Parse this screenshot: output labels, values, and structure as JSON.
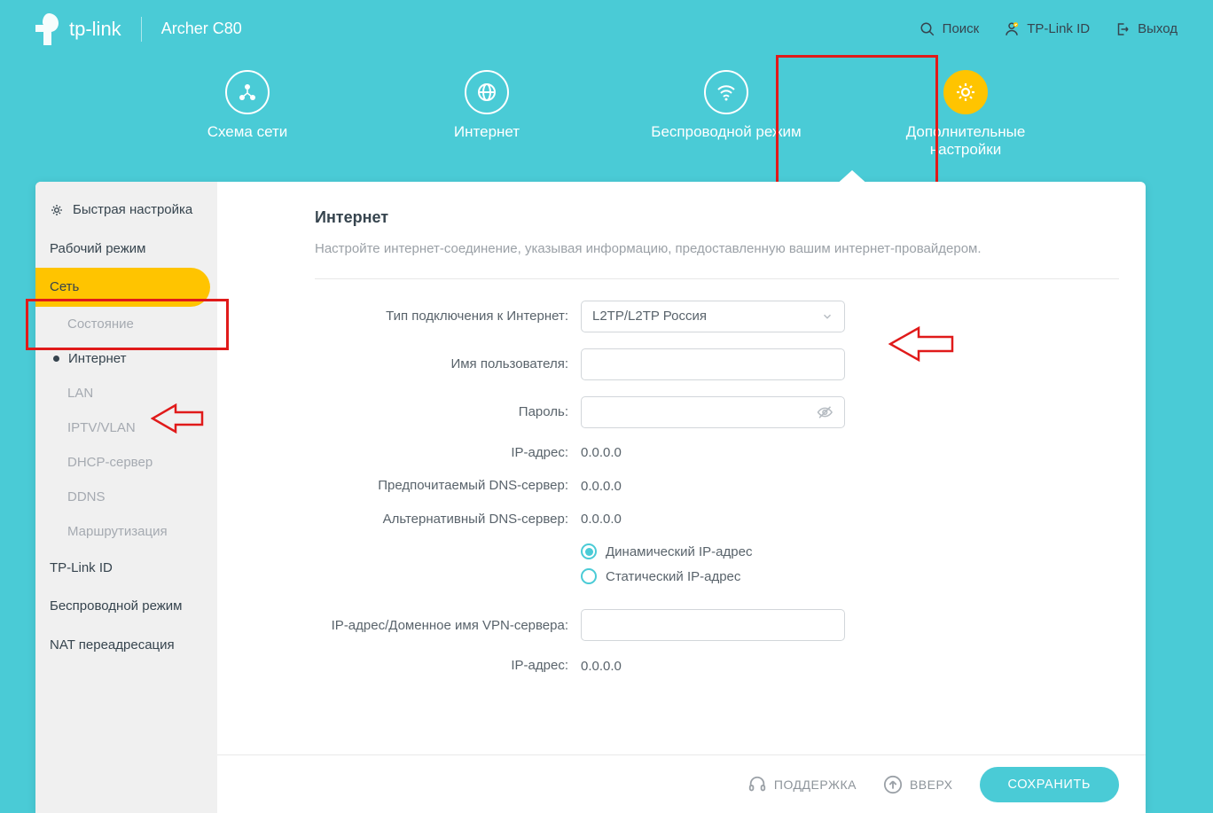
{
  "brand": "tp-link",
  "model": "Archer C80",
  "top_links": {
    "search": "Поиск",
    "tplink_id": "TP-Link ID",
    "logout": "Выход"
  },
  "tabs": {
    "network_map": "Схема сети",
    "internet": "Интернет",
    "wireless": "Беспроводной режим",
    "advanced": "Дополнительные настройки"
  },
  "sidebar": {
    "quick_setup": "Быстрая настройка",
    "operation_mode": "Рабочий режим",
    "network": "Сеть",
    "status": "Состояние",
    "internet": "Интернет",
    "lan": "LAN",
    "iptv": "IPTV/VLAN",
    "dhcp": "DHCP-сервер",
    "ddns": "DDNS",
    "routing": "Маршрутизация",
    "tplink_id": "TP-Link ID",
    "wireless": "Беспроводной режим",
    "nat": "NAT переадресация"
  },
  "page": {
    "title": "Интернет",
    "desc": "Настройте интернет-соединение, указывая информацию, предоставленную вашим интернет-провайдером.",
    "labels": {
      "conn_type": "Тип подключения к Интернет:",
      "username": "Имя пользователя:",
      "password": "Пароль:",
      "ip": "IP-адрес:",
      "pref_dns": "Предпочитаемый DNS-сервер:",
      "alt_dns": "Альтернативный DNS-сервер:",
      "dyn_ip": "Динамический IP-адрес",
      "stat_ip": "Статический IP-адрес",
      "vpn_server": "IP-адрес/Доменное имя VPN-сервера:",
      "ip2": "IP-адрес:"
    },
    "values": {
      "conn_type": "L2TP/L2TP Россия",
      "ip": "0.0.0.0",
      "pref_dns": "0.0.0.0",
      "alt_dns": "0.0.0.0",
      "ip2": "0.0.0.0"
    }
  },
  "footer": {
    "support": "ПОДДЕРЖКА",
    "top": "ВВЕРХ",
    "save": "СОХРАНИТЬ"
  }
}
